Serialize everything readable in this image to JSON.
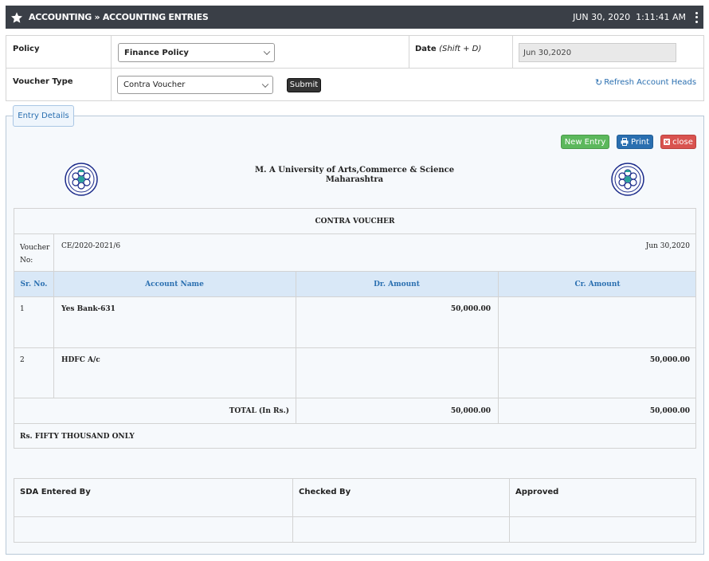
{
  "header": {
    "title": "ACCOUNTING » ACCOUNTING ENTRIES",
    "date": "JUN 30, 2020",
    "time": "1:11:41 AM"
  },
  "filters": {
    "policy_label": "Policy",
    "policy_value": "Finance Policy",
    "date_label": "Date",
    "date_hint": "(Shift + D)",
    "date_value": "Jun 30,2020",
    "voucher_type_label": "Voucher Type",
    "voucher_type_value": "Contra Voucher",
    "submit_label": "Submit",
    "refresh_label": "Refresh Account Heads"
  },
  "entry": {
    "tab_label": "Entry Details",
    "new_entry_label": "New Entry",
    "print_label": "Print",
    "close_label": "close",
    "university_line1": "M. A University of Arts,Commerce & Science",
    "university_line2": "Maharashtra"
  },
  "voucher": {
    "title": "CONTRA VOUCHER",
    "voucher_no_label_1": "Voucher",
    "voucher_no_label_2": "No:",
    "voucher_no": "CE/2020-2021/6",
    "date": "Jun 30,2020",
    "columns": {
      "sr": "Sr. No.",
      "account": "Account Name",
      "dr": "Dr. Amount",
      "cr": "Cr. Amount"
    },
    "rows": [
      {
        "sr": "1",
        "account": "Yes Bank-631",
        "dr": "50,000.00",
        "cr": ""
      },
      {
        "sr": "2",
        "account": "HDFC A/c",
        "dr": "",
        "cr": "50,000.00"
      }
    ],
    "total_label": "TOTAL (In Rs.)",
    "total_dr": "50,000.00",
    "total_cr": "50,000.00",
    "amount_words": "Rs. FIFTY THOUSAND ONLY"
  },
  "signatures": {
    "entered_by": "SDA Entered By",
    "checked_by": "Checked By",
    "approved": "Approved"
  },
  "colors": {
    "topbar": "#3a3f47",
    "accent_blue": "#2a6fb0",
    "green": "#5cb85c",
    "red": "#d9534f"
  }
}
